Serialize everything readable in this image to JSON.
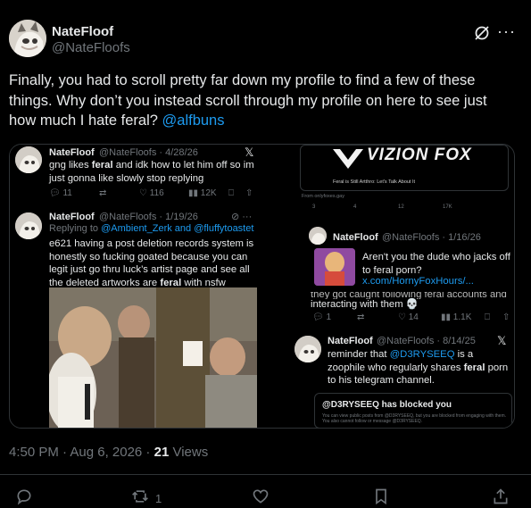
{
  "header": {
    "display_name": "NateFloof",
    "handle": "@NateFloofs",
    "grok_icon": "grok-slash-icon",
    "more_label": "···"
  },
  "tweet": {
    "text": "Finally, you had to scroll pretty far down my profile to find a few of these things. Why don’t you instead scroll through my profile on here to see just how much I hate feral? ",
    "mention": "@alfbuns"
  },
  "media": {
    "top_left": {
      "name": "NateFloof",
      "meta": "@NateFloofs · 4/28/26",
      "body_a": "gng likes ",
      "body_b": "feral",
      "body_c": " and idk how to let him off so im just gonna like slowly stop replying",
      "replies": "11",
      "likes": "116",
      "views": "12K"
    },
    "mid_left": {
      "name": "NateFloof",
      "meta": "@NateFloofs · 1/19/26",
      "replying_prefix": "Replying to ",
      "replying_to": "@Ambient_Zerk and @fluffytoastet",
      "body": "e621 having a post deletion records system is honestly so fucking goated because you can legit just go thru luck’s artist page and see all the deleted artworks are ",
      "body_b": "feral",
      "body_c": " with nsfw ratings"
    },
    "top_right": {
      "logo_text": "VIZION FOX",
      "caption": "Feral is Still Artthro: Let's Talk About It",
      "source": "From onlyfoxes.gay",
      "replies": "3",
      "retweets": "4",
      "likes": "12",
      "views": "17K"
    },
    "mid_right": {
      "name": "NateFloof",
      "meta": "@NateFloofs · 1/16/26",
      "body": "Aren't you the dude who jacks off to feral porn?",
      "link": "x.com/HornyFoxHours/...",
      "overflow": "they got caught following feral accounts and",
      "tail": "interacting with them 💀",
      "replies": "1",
      "likes": "14",
      "views": "1.1K"
    },
    "bottom_right": {
      "name": "NateFloof",
      "meta": "@NateFloofs · 8/14/25",
      "body_a": "reminder that ",
      "body_mention": "@D3RYSEEQ",
      "body_b": " is a zoophile who regularly shares ",
      "body_feral": "feral",
      "body_c": " porn to his telegram channel.",
      "blocked_title": "@D3RYSEEQ has blocked you",
      "blocked_sub": "You can view public posts from @D3RYSEEQ, but you are blocked from engaging with them. You also cannot follow or message @D3RYSEEQ."
    }
  },
  "footer": {
    "time": "4:50 PM · Aug 6, 2026 · ",
    "views_count": "21",
    "views_label": " Views",
    "retweets": "1"
  },
  "colors": {
    "background": "#000000",
    "text": "#e7e9ea",
    "muted": "#71767b",
    "link": "#1d9bf0",
    "border": "#2f3336"
  }
}
